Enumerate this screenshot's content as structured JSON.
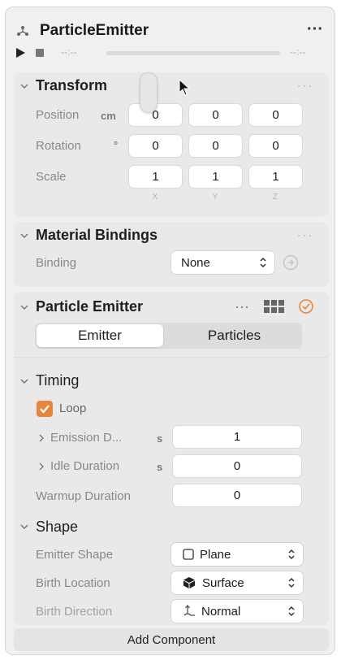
{
  "header": {
    "title": "ParticleEmitter",
    "time_start": "--:--",
    "time_end": "--:--"
  },
  "transform": {
    "title": "Transform",
    "rows": [
      {
        "label": "Position",
        "unit": "cm",
        "values": [
          "0",
          "0",
          "0"
        ]
      },
      {
        "label": "Rotation",
        "unit": "°",
        "values": [
          "0",
          "0",
          "0"
        ]
      },
      {
        "label": "Scale",
        "unit": "",
        "values": [
          "1",
          "1",
          "1"
        ]
      }
    ],
    "axes": [
      "X",
      "Y",
      "Z"
    ]
  },
  "material": {
    "title": "Material Bindings",
    "binding_label": "Binding",
    "binding_value": "None"
  },
  "emitter": {
    "title": "Particle Emitter",
    "tabs": [
      "Emitter",
      "Particles"
    ],
    "timing": {
      "title": "Timing",
      "loop_label": "Loop",
      "emission_label": "Emission D...",
      "emission_unit": "s",
      "emission_value": "1",
      "idle_label": "Idle Duration",
      "idle_unit": "s",
      "idle_value": "0",
      "warmup_label": "Warmup Duration",
      "warmup_value": "0"
    },
    "shape": {
      "title": "Shape",
      "emitter_shape_label": "Emitter Shape",
      "emitter_shape_value": "Plane",
      "birth_location_label": "Birth Location",
      "birth_location_value": "Surface",
      "birth_direction_label": "Birth Direction",
      "birth_direction_value": "Normal"
    }
  },
  "footer": {
    "add_component": "Add Component"
  },
  "colors": {
    "accent_orange": "#e8853a",
    "panel_bg": "#f0f0f0",
    "section_bg": "#e9e9e9"
  }
}
